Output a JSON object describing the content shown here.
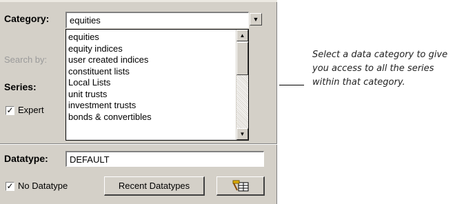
{
  "category": {
    "label": "Category:",
    "value": "equities"
  },
  "dropdown": {
    "items": [
      "equities",
      "equity indices",
      "user created indices",
      "constituent lists",
      "Local Lists",
      "unit trusts",
      "investment trusts",
      "bonds & convertibles"
    ]
  },
  "search_by": {
    "label": "Search by:"
  },
  "series": {
    "label": "Series:"
  },
  "expert": {
    "label": "Expert",
    "checked": true
  },
  "datatype": {
    "label": "Datatype:",
    "value": "DEFAULT"
  },
  "no_datatype": {
    "label": "No Datatype",
    "checked": true
  },
  "recent_datatypes_button": {
    "label": "Recent Datatypes"
  },
  "picker_button": {
    "icon": "datatype-picker-icon"
  },
  "callout": {
    "text": "Select a data category to give you access to all the series within that category."
  },
  "colors": {
    "panel": "#d4d0c8",
    "highlight": "#ffffff",
    "shadow": "#808080"
  }
}
